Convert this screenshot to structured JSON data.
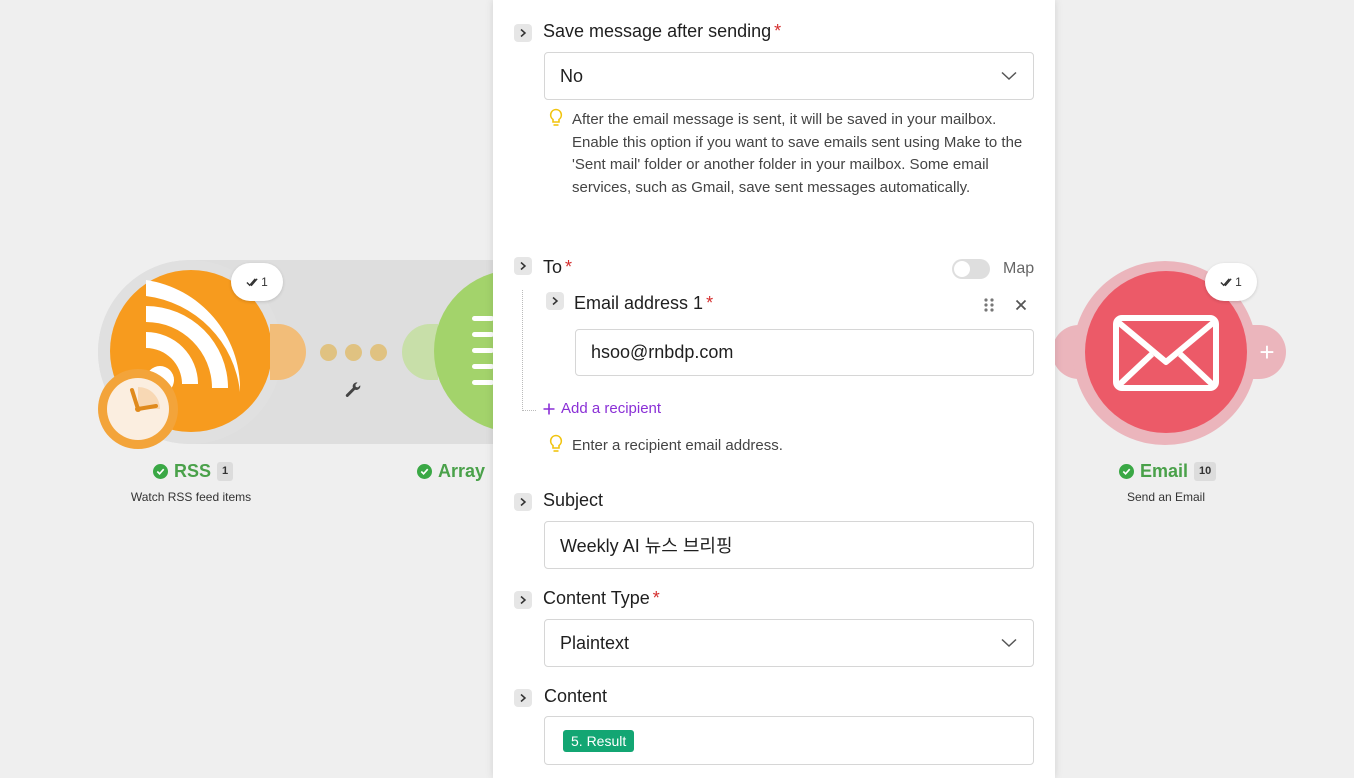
{
  "canvas": {
    "modules": [
      {
        "id": "rss",
        "title": "RSS",
        "count": "1",
        "subtitle": "Watch RSS feed items",
        "badge": "1",
        "color": "#f79b1e"
      },
      {
        "id": "array",
        "title": "Array",
        "color": "#a3d36b"
      },
      {
        "id": "email",
        "title": "Email",
        "count": "10",
        "subtitle": "Send an Email",
        "badge": "1",
        "color": "#ec5a68"
      }
    ]
  },
  "panel": {
    "save_message": {
      "label": "Save message after sending",
      "required_mark": "*",
      "value": "No",
      "hint": "After the email message is sent, it will be saved in your mailbox. Enable this option if you want to save emails sent using Make to the 'Sent mail' folder or another folder in your mailbox. Some email services, such as Gmail, save sent messages automatically."
    },
    "to": {
      "label": "To",
      "required_mark": "*",
      "map_label": "Map",
      "recipient": {
        "label": "Email address 1",
        "required_mark": "*",
        "value": "hsoo@rnbdp.com"
      },
      "add_recipient": "Add a recipient",
      "hint": "Enter a recipient email address."
    },
    "subject": {
      "label": "Subject",
      "value": "Weekly AI 뉴스 브리핑"
    },
    "content_type": {
      "label": "Content Type",
      "required_mark": "*",
      "value": "Plaintext"
    },
    "content": {
      "label": "Content",
      "token": "5. Result",
      "token_color": "#13a673"
    }
  }
}
